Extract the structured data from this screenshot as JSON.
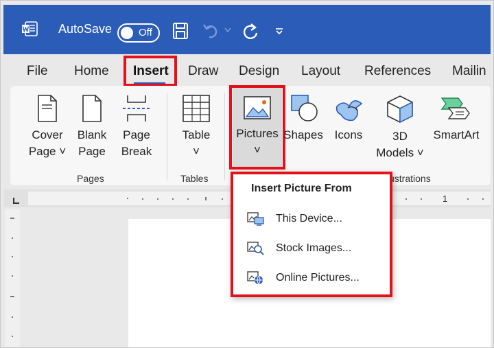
{
  "titlebar": {
    "autosave_label": "AutoSave",
    "toggle_state": "Off",
    "colors": {
      "brand": "#2b5cb8",
      "highlight": "#e3111b"
    }
  },
  "tabs": [
    {
      "label": "File"
    },
    {
      "label": "Home"
    },
    {
      "label": "Insert",
      "active": true
    },
    {
      "label": "Draw"
    },
    {
      "label": "Design"
    },
    {
      "label": "Layout"
    },
    {
      "label": "References"
    },
    {
      "label": "Mailin"
    }
  ],
  "ribbon": {
    "pages": {
      "cover_page": [
        "Cover",
        "Page ˅"
      ],
      "blank_page": [
        "Blank",
        "Page"
      ],
      "page_break": [
        "Page",
        "Break"
      ],
      "group_label": "Pages"
    },
    "tables": {
      "table": [
        "Table",
        "˅"
      ],
      "group_label": "Tables"
    },
    "illustrations": {
      "pictures": [
        "Pictures",
        "˅"
      ],
      "shapes": "Shapes",
      "icons": "Icons",
      "models_3d": [
        "3D",
        "Models ˅"
      ],
      "smartart": "SmartArt",
      "group_label": "ustrations"
    }
  },
  "ruler": {
    "marker": "1"
  },
  "dropdown": {
    "title": "Insert Picture From",
    "items": [
      {
        "label": "This Device...",
        "icon": "device-picture-icon"
      },
      {
        "label": "Stock Images...",
        "icon": "stock-images-icon"
      },
      {
        "label": "Online Pictures...",
        "icon": "online-pictures-icon"
      }
    ]
  }
}
